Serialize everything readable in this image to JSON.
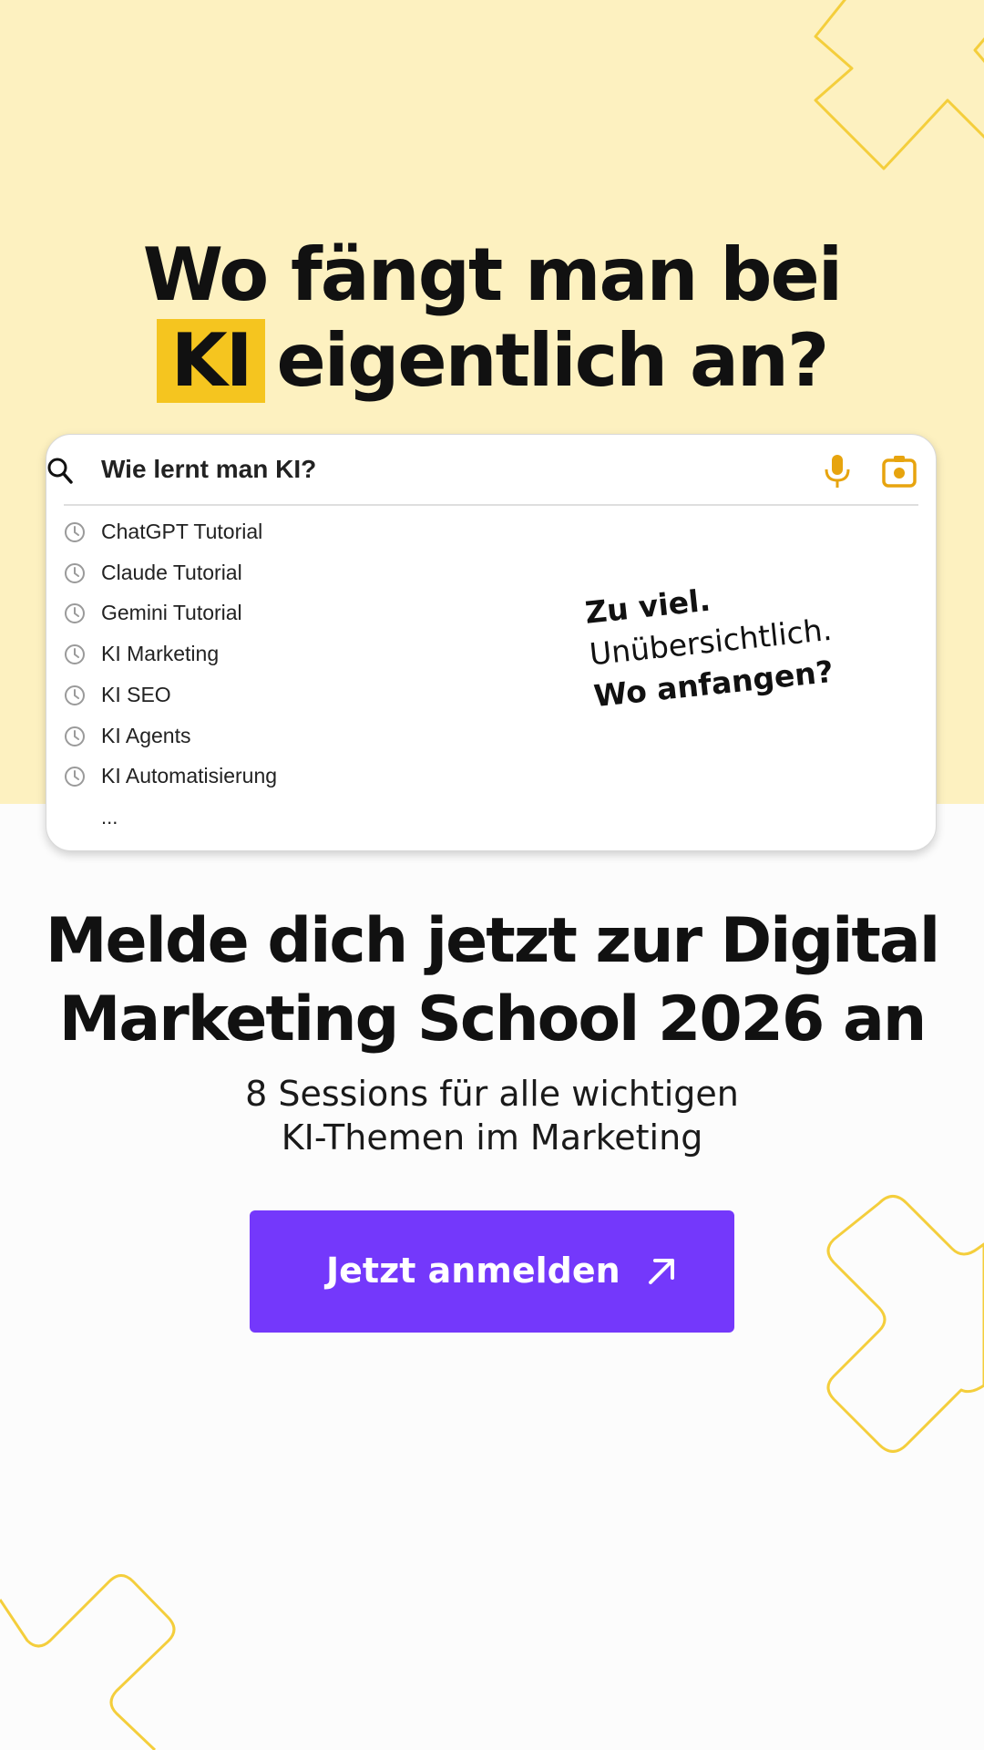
{
  "colors": {
    "top_background": "#fdf1c0",
    "bottom_background": "#fcfcfc",
    "highlight": "#f5c51f",
    "accent_icon": "#e7a40e",
    "button": "#7438fb",
    "deco_stroke": "#f4ce3c"
  },
  "hero": {
    "line1": "Wo fängt man bei",
    "highlight": "KI",
    "line2_rest": "eigentlich an?"
  },
  "search": {
    "query": "Wie lernt man KI?",
    "search_icon": "search-icon",
    "mic_icon": "microphone-icon",
    "camera_icon": "camera-icon",
    "suggestions": [
      {
        "label": "ChatGPT Tutorial",
        "icon": "history-icon"
      },
      {
        "label": "Claude Tutorial",
        "icon": "history-icon"
      },
      {
        "label": "Gemini Tutorial",
        "icon": "history-icon"
      },
      {
        "label": "KI Marketing",
        "icon": "history-icon"
      },
      {
        "label": "KI SEO",
        "icon": "history-icon"
      },
      {
        "label": "KI Agents",
        "icon": "history-icon"
      },
      {
        "label": "KI Automatisierung",
        "icon": "history-icon"
      }
    ],
    "more": "..."
  },
  "handnote": {
    "line1": "Zu viel.",
    "line2": "Unübersichtlich.",
    "line3": "Wo anfangen?"
  },
  "cta": {
    "title_line1": "Melde dich jetzt zur Digital",
    "title_line2": "Marketing School 2026 an",
    "subtitle_line1": "8 Sessions für alle wichtigen",
    "subtitle_line2": "KI-Themen im Marketing",
    "button_label": "Jetzt anmelden",
    "button_icon": "arrow-up-right-icon"
  }
}
